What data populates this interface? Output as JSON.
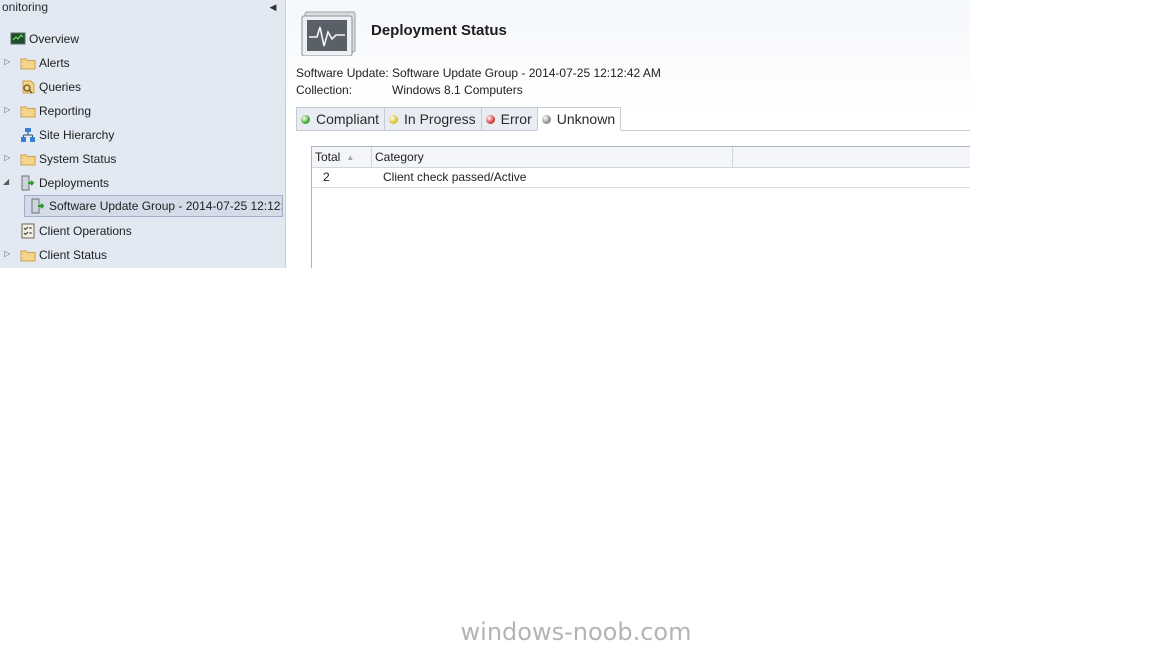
{
  "nav": {
    "header": "onitoring",
    "collapse_glyph": "◀",
    "items": [
      {
        "label": "Overview",
        "icon": "overview-icon"
      },
      {
        "label": "Alerts",
        "icon": "folder-icon"
      },
      {
        "label": "Queries",
        "icon": "queries-icon"
      },
      {
        "label": "Reporting",
        "icon": "folder-icon"
      },
      {
        "label": "Site Hierarchy",
        "icon": "site-hierarchy-icon"
      },
      {
        "label": "System Status",
        "icon": "folder-icon"
      },
      {
        "label": "Deployments",
        "icon": "deployments-icon"
      },
      {
        "label": "Software Update Group - 2014-07-25 12:12:",
        "icon": "deployment-item-icon"
      },
      {
        "label": "Client Operations",
        "icon": "client-operations-icon"
      },
      {
        "label": "Client Status",
        "icon": "folder-icon"
      }
    ]
  },
  "main": {
    "title": "Deployment Status",
    "software_update_label": "Software Update:",
    "software_update_value": "Software Update Group - 2014-07-25 12:12:42 AM",
    "collection_label": "Collection:",
    "collection_value": "Windows 8.1 Computers",
    "tabs": [
      {
        "label": "Compliant",
        "color": "#3cab2e"
      },
      {
        "label": "In Progress",
        "color": "#d8c12a"
      },
      {
        "label": "Error",
        "color": "#d63b3b"
      },
      {
        "label": "Unknown",
        "color": "#8a8f96"
      }
    ],
    "active_tab": "Unknown",
    "grid": {
      "columns": [
        "Total",
        "Category"
      ],
      "rows": [
        {
          "total": "2",
          "category": "Client check passed/Active"
        }
      ]
    }
  },
  "watermark": "windows-noob.com"
}
